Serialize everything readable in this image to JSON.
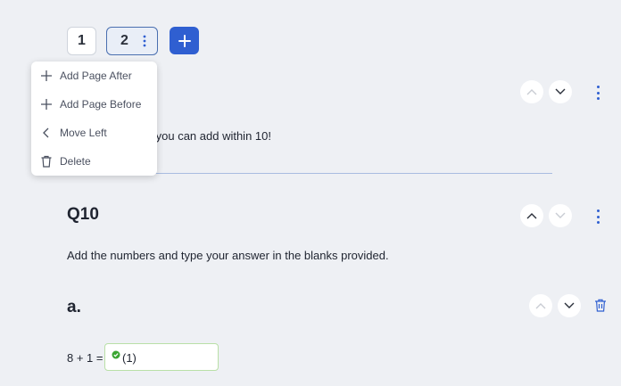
{
  "pages": {
    "tab1": "1",
    "tab2": "2"
  },
  "menu": {
    "items": [
      {
        "icon": "plus-icon",
        "label": "Add Page After"
      },
      {
        "icon": "plus-icon",
        "label": "Add Page Before"
      },
      {
        "icon": "chevron-left-icon",
        "label": "Move Left"
      },
      {
        "icon": "trash-icon",
        "label": "Delete"
      }
    ]
  },
  "question9": {
    "text_partial": "ell you can add within 10!"
  },
  "question10": {
    "title": "Q10",
    "instruction": "Add the numbers and type your answer in the blanks provided."
  },
  "subquestion": {
    "label": "a.",
    "equation": "8 + 1 =",
    "answer": "(1)"
  },
  "colors": {
    "accent": "#2f5fd1",
    "success": "#3aa531",
    "background": "#eef0f4"
  }
}
